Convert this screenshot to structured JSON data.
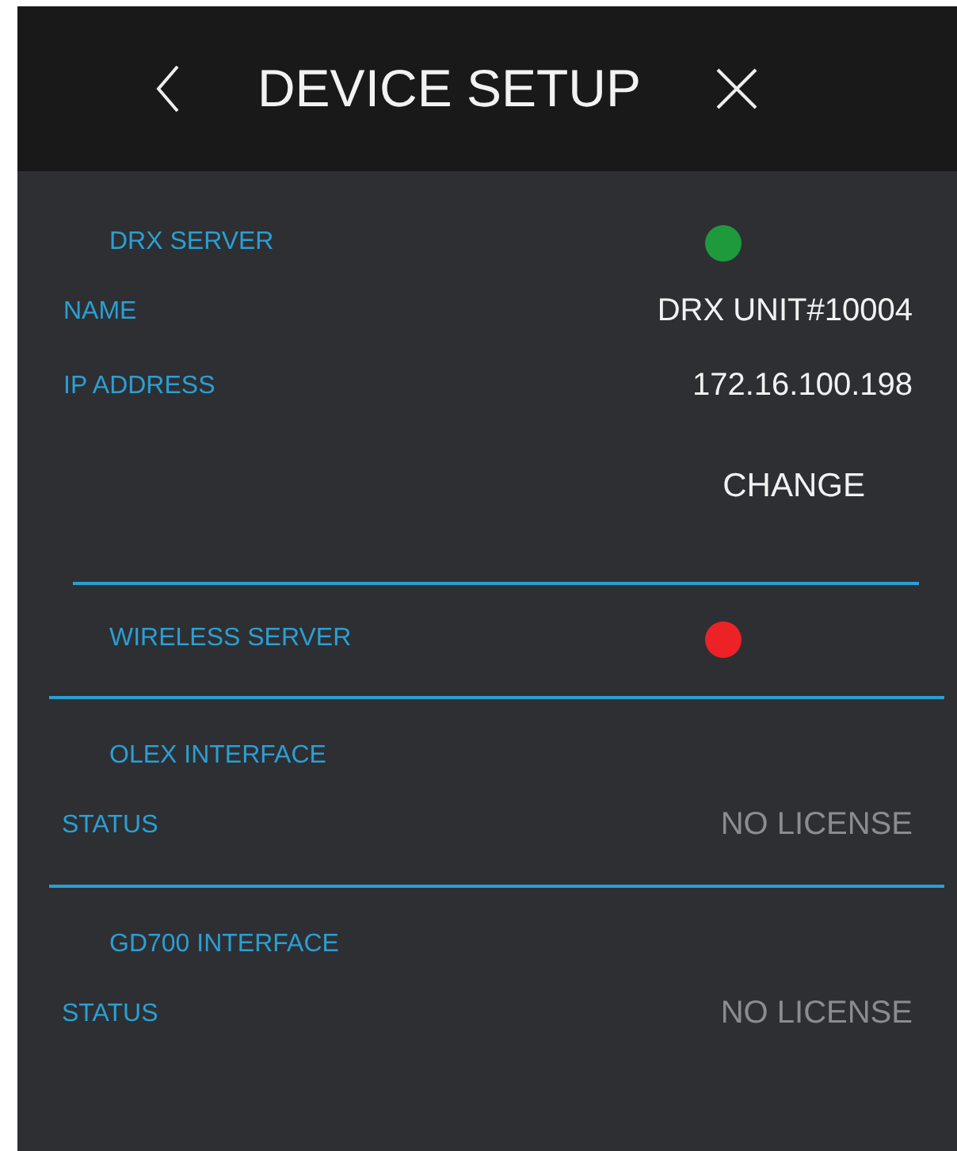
{
  "header": {
    "title": "DEVICE SETUP"
  },
  "sections": [
    {
      "title": "DRX SERVER",
      "color": "#1e9a3c",
      "rows": [
        {
          "label": "NAME",
          "value": "DRX UNIT#10004",
          "kind": "value"
        },
        {
          "label": "IP ADDRESS",
          "value": "172.16.100.198",
          "kind": "value"
        }
      ],
      "button": "CHANGE"
    },
    {
      "title": "WIRELESS SERVER",
      "color": "#ec2227"
    },
    {
      "title": "OLEX INTERFACE",
      "rows": [
        {
          "label": "STATUS",
          "value": "NO LICENSE",
          "kind": "muted"
        }
      ]
    },
    {
      "title": "GD700 INTERFACE",
      "rows": [
        {
          "label": "STATUS",
          "value": "NO LICENSE",
          "kind": "muted"
        }
      ]
    }
  ]
}
